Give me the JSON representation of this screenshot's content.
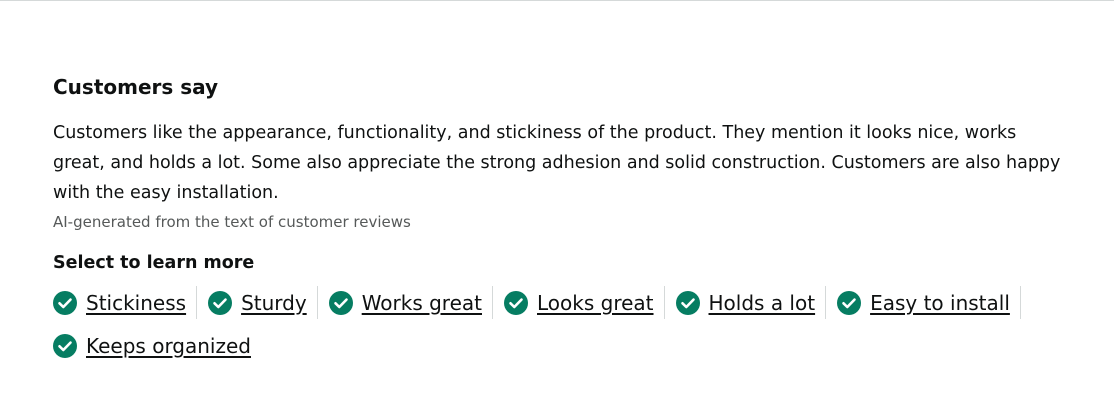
{
  "section": {
    "title": "Customers say",
    "summary": "Customers like the appearance, functionality, and stickiness of the product. They mention it looks nice, works great, and holds a lot. Some also appreciate the strong adhesion and solid construction. Customers are also happy with the easy installation.",
    "ai_note": "AI-generated from the text of customer reviews",
    "select_heading": "Select to learn more"
  },
  "aspects": [
    {
      "label": "Stickiness",
      "icon": "check-circle-icon"
    },
    {
      "label": "Sturdy",
      "icon": "check-circle-icon"
    },
    {
      "label": "Works great",
      "icon": "check-circle-icon"
    },
    {
      "label": "Looks great",
      "icon": "check-circle-icon"
    },
    {
      "label": "Holds a lot",
      "icon": "check-circle-icon"
    },
    {
      "label": "Easy to install",
      "icon": "check-circle-icon"
    },
    {
      "label": "Keeps organized",
      "icon": "check-circle-icon"
    }
  ],
  "colors": {
    "positive": "#067d62",
    "text": "#0f1111",
    "muted": "#565959",
    "divider": "#d5d9d9"
  }
}
